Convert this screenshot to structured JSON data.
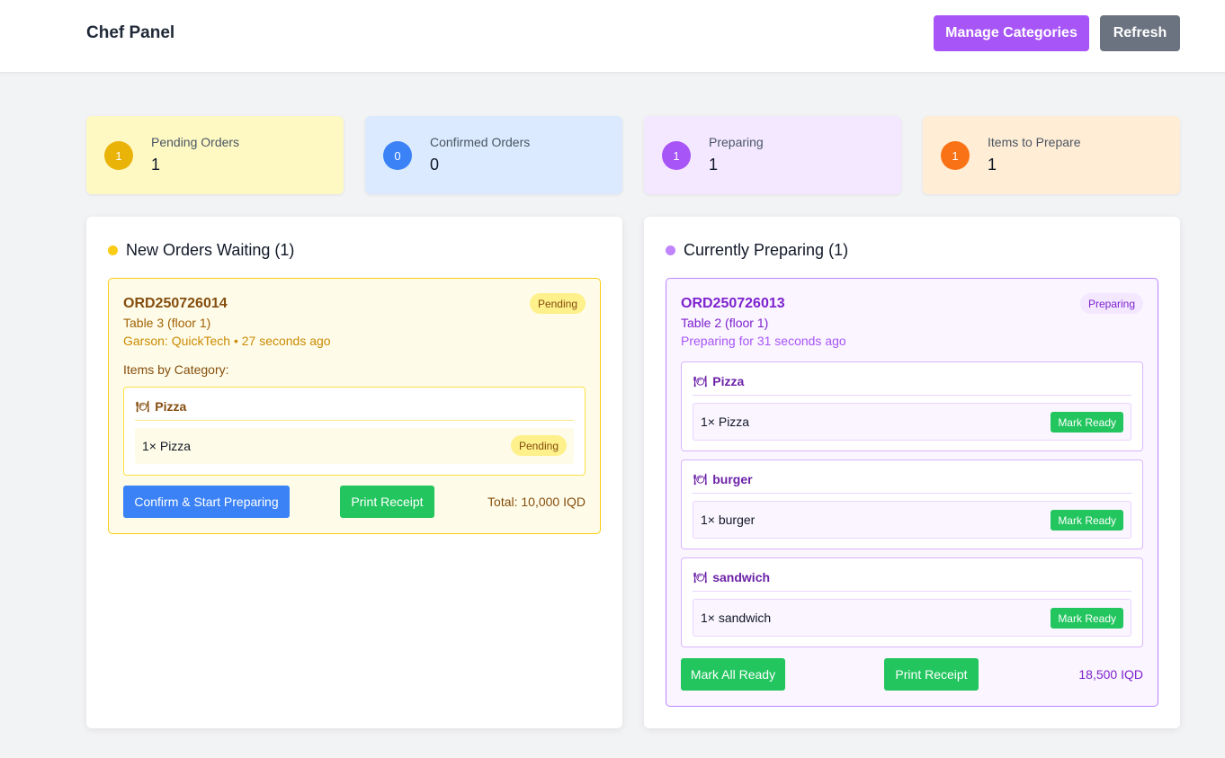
{
  "header": {
    "title": "Chef Panel",
    "manage_categories": "Manage Categories",
    "refresh": "Refresh"
  },
  "stats": [
    {
      "badge": "1",
      "label": "Pending Orders",
      "value": "1",
      "bg": "#fef9c3",
      "accent": "#eab308"
    },
    {
      "badge": "0",
      "label": "Confirmed Orders",
      "value": "0",
      "bg": "#dbeafe",
      "accent": "#3b82f6"
    },
    {
      "badge": "1",
      "label": "Preparing",
      "value": "1",
      "bg": "#f3e8ff",
      "accent": "#a855f7"
    },
    {
      "badge": "1",
      "label": "Items to Prepare",
      "value": "1",
      "bg": "#ffedd5",
      "accent": "#f97316"
    }
  ],
  "new_orders": {
    "title": "New Orders Waiting (1)",
    "order": {
      "id": "ORD250726014",
      "status": "Pending",
      "table": "Table 3 (floor 1)",
      "meta": "Garson: QuickTech • 27 seconds ago",
      "items_heading": "Items by Category:",
      "category": {
        "icon": "plate-icon",
        "name": "Pizza",
        "item": "1× Pizza",
        "item_status": "Pending"
      },
      "confirm_button": "Confirm & Start Preparing",
      "print_button": "Print Receipt",
      "total": "Total: 10,000 IQD"
    }
  },
  "preparing": {
    "title": "Currently Preparing (1)",
    "order": {
      "id": "ORD250726013",
      "status": "Preparing",
      "table": "Table 2 (floor 1)",
      "meta": "Preparing for 31 seconds ago",
      "categories": [
        {
          "icon": "plate-icon",
          "name": "Pizza",
          "item": "1× Pizza",
          "action": "Mark Ready"
        },
        {
          "icon": "plate-icon",
          "name": "burger",
          "item": "1× burger",
          "action": "Mark Ready"
        },
        {
          "icon": "plate-icon",
          "name": "sandwich",
          "item": "1× sandwich",
          "action": "Mark Ready"
        }
      ],
      "mark_all_button": "Mark All Ready",
      "print_button": "Print Receipt",
      "total": "18,500 IQD"
    }
  }
}
